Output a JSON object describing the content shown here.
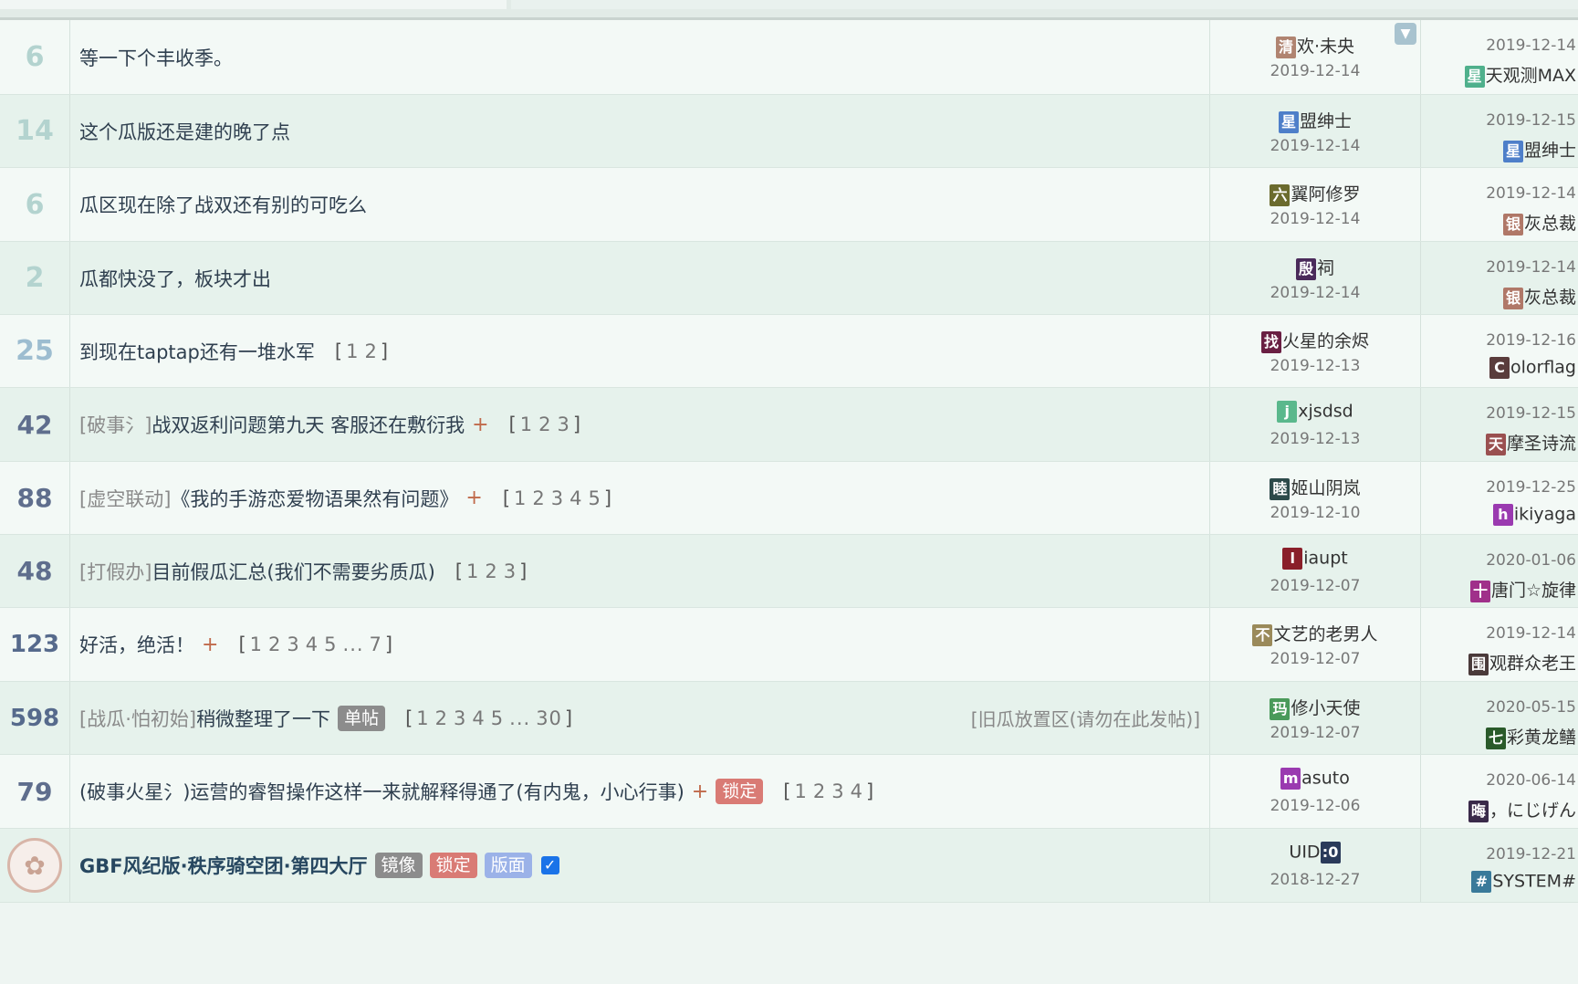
{
  "rows": [
    {
      "count": "6",
      "title": "等一下个丰收季。",
      "author": {
        "avatar": "清",
        "avatar_color": "#b08471",
        "name": "欢·未央",
        "date": "2019-12-14"
      },
      "last": {
        "date": "2019-12-14",
        "avatar": "星",
        "avatar_color": "#4fb08c",
        "name": "天观测MAX"
      }
    },
    {
      "count": "14",
      "title": "这个瓜版还是建的晚了点",
      "author": {
        "avatar": "星",
        "avatar_color": "#4e7fc9",
        "name": "盟绅士",
        "date": "2019-12-14"
      },
      "last": {
        "date": "2019-12-15",
        "avatar": "星",
        "avatar_color": "#4e7fc9",
        "name": "盟绅士"
      }
    },
    {
      "count": "6",
      "title": "瓜区现在除了战双还有别的可吃么",
      "author": {
        "avatar": "六",
        "avatar_color": "#6b6b2e",
        "name": "翼阿修罗",
        "date": "2019-12-14"
      },
      "last": {
        "date": "2019-12-14",
        "avatar": "银",
        "avatar_color": "#b07868",
        "name": "灰总裁"
      }
    },
    {
      "count": "2",
      "title": "瓜都快没了，板块才出",
      "author": {
        "avatar": "殷",
        "avatar_color": "#4a2a5a",
        "name": "祠",
        "date": "2019-12-14"
      },
      "last": {
        "date": "2019-12-14",
        "avatar": "银",
        "avatar_color": "#b07868",
        "name": "灰总裁"
      }
    },
    {
      "count": "25",
      "title": "到现在taptap还有一堆水军",
      "pages": [
        "1",
        "2"
      ],
      "author": {
        "avatar": "找",
        "avatar_color": "#6a1f43",
        "name": "火星的余烬",
        "date": "2019-12-13"
      },
      "last": {
        "date": "2019-12-16",
        "avatar": "C",
        "avatar_color": "#5a3c3c",
        "name": "olorflag"
      }
    },
    {
      "count": "42",
      "tag": "[破事氵]",
      "title": "战双返利问题第九天 客服还在敷衍我",
      "plus": "+",
      "pages": [
        "1",
        "2",
        "3"
      ],
      "author": {
        "avatar": "j",
        "avatar_color": "#5ab88c",
        "name": "xjsdsd",
        "date": "2019-12-13"
      },
      "last": {
        "date": "2019-12-15",
        "avatar": "天",
        "avatar_color": "#9a5050",
        "name": "摩圣诗流"
      }
    },
    {
      "count": "88",
      "tag": "[虚空联动]",
      "title": "《我的手游恋爱物语果然有问题》",
      "plus": "+",
      "pages": [
        "1",
        "2",
        "3",
        "4",
        "5"
      ],
      "author": {
        "avatar": "睦",
        "avatar_color": "#2c4a4a",
        "name": "姬山阴岚",
        "date": "2019-12-10"
      },
      "last": {
        "date": "2019-12-25",
        "avatar": "h",
        "avatar_color": "#9a3ab0",
        "name": "ikiyaga"
      }
    },
    {
      "count": "48",
      "tag": "[打假办]",
      "title": "目前假瓜汇总(我们不需要劣质瓜)",
      "pages": [
        "1",
        "2",
        "3"
      ],
      "author": {
        "avatar": "l",
        "avatar_color": "#8a1f2a",
        "name": "iaupt",
        "date": "2019-12-07"
      },
      "last": {
        "date": "2020-01-06",
        "avatar": "十",
        "avatar_color": "#a0308a",
        "name": "唐门☆旋律"
      }
    },
    {
      "count": "123",
      "title": "好活，绝活！",
      "plus": "+",
      "pages": [
        "1",
        "2",
        "3",
        "4",
        "5",
        "...",
        "7"
      ],
      "author": {
        "avatar": "不",
        "avatar_color": "#9a8a5a",
        "name": "文艺的老男人",
        "date": "2019-12-07"
      },
      "last": {
        "date": "2019-12-14",
        "avatar": "围",
        "avatar_color": "#4a3a3a",
        "name": "观群众老王"
      }
    },
    {
      "count": "598",
      "tag": "[战瓜·怕初始]",
      "title": "稍微整理了一下",
      "badges": [
        {
          "text": "单帖",
          "style": "gray"
        }
      ],
      "pages": [
        "1",
        "2",
        "3",
        "4",
        "5",
        "...",
        "30"
      ],
      "forum": "[旧瓜放置区(请勿在此发帖)]",
      "author": {
        "avatar": "玛",
        "avatar_color": "#4a9a5a",
        "name": "修小天使",
        "date": "2019-12-07"
      },
      "last": {
        "date": "2020-05-15",
        "avatar": "七",
        "avatar_color": "#2a5a2a",
        "name": "彩黄龙鳝"
      }
    },
    {
      "count": "79",
      "title": "(破事火星氵)运营的睿智操作这样一来就解释得通了(有内鬼，小心行事)",
      "plus": "+",
      "badges": [
        {
          "text": "锁定",
          "style": "red"
        }
      ],
      "pages": [
        "1",
        "2",
        "3",
        "4"
      ],
      "author": {
        "avatar": "m",
        "avatar_color": "#9a3ab0",
        "name": "asuto",
        "date": "2019-12-06"
      },
      "last": {
        "date": "2020-06-14",
        "avatar": "晦",
        "avatar_color": "#3a2a4a",
        "name": "，にじげん"
      }
    },
    {
      "count": "",
      "forum_icon": true,
      "title": "GBF风纪版·秩序骑空团·第四大厅",
      "bold": true,
      "badges": [
        {
          "text": "镜像",
          "style": "gray"
        },
        {
          "text": "锁定",
          "style": "red"
        },
        {
          "text": "版面",
          "style": "blue"
        }
      ],
      "checkbox": true,
      "author": {
        "prefix": "UID",
        "avatar": ":0",
        "avatar_color": "#2a3a5a",
        "name": "",
        "date": "2018-12-27"
      },
      "last": {
        "date": "2019-12-21",
        "avatar": "#",
        "avatar_color": "#3a7a9a",
        "name": "SYSTEM#"
      }
    }
  ],
  "collapse_icon": "▼",
  "checkbox_glyph": "✓",
  "forum_icon_glyph": "✿"
}
